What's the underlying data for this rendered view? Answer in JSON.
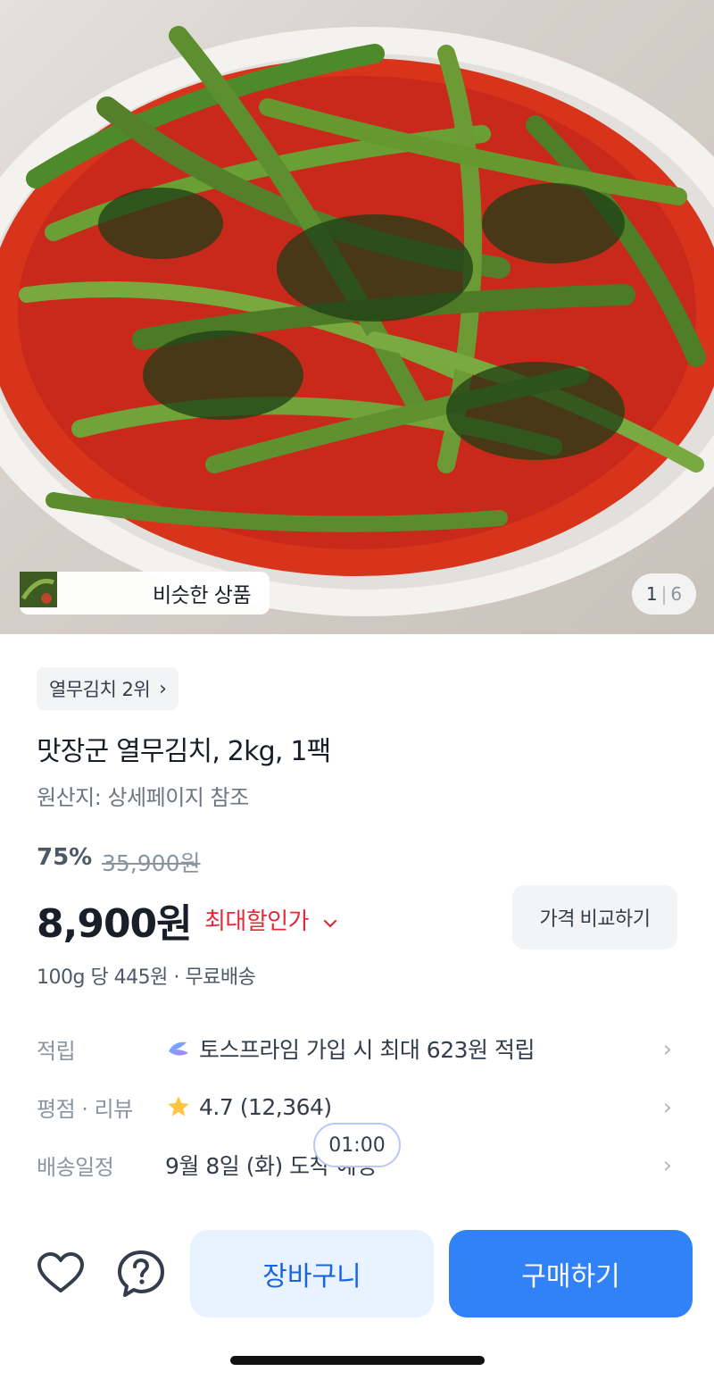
{
  "hero": {
    "similar_label": "비슷한 상품",
    "counter_current": "1",
    "counter_separator": "|",
    "counter_total": "6"
  },
  "product": {
    "rank_label": "열무김치 2위",
    "title": "맛장군 열무김치, 2kg, 1팩",
    "origin": "원산지: 상세페이지 참조",
    "discount_rate": "75%",
    "original_price": "35,900원",
    "price": "8,900원",
    "max_discount_label": "최대할인가",
    "compare_button": "가격 비교하기",
    "unit_price": "100g 당 445원 · 무료배송"
  },
  "info": {
    "reward_label": "적립",
    "reward_value": "토스프라임 가입 시 최대 623원 적립",
    "rating_label": "평점 · 리뷰",
    "rating_value": "4.7 (12,364)",
    "delivery_label": "배송일정",
    "delivery_value": "9월 8일 (화) 도착 예정"
  },
  "timer": "01:00",
  "bottom_bar": {
    "cart_label": "장바구니",
    "buy_label": "구매하기"
  },
  "colors": {
    "primary_blue": "#3182f6",
    "cart_bg": "#e8f3ff",
    "discount_red": "#e42939",
    "star": "#ffc342"
  },
  "icons": [
    "chevron-right-icon",
    "prime-logo-icon",
    "star-icon",
    "heart-icon",
    "question-icon"
  ]
}
